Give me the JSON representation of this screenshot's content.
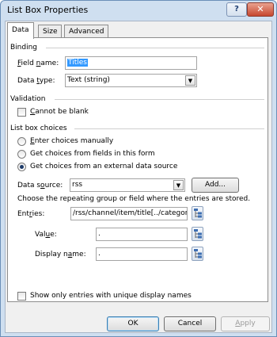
{
  "window": {
    "title": "List Box Properties",
    "help_glyph": "?",
    "close_glyph": "✕"
  },
  "tabs": [
    {
      "label": "Data",
      "active": true
    },
    {
      "label": "Size",
      "active": false
    },
    {
      "label": "Advanced",
      "active": false
    }
  ],
  "binding": {
    "heading": "Binding",
    "field_name_label": "Field name:",
    "field_name_value": "Titles",
    "data_type_label": "Data type:",
    "data_type_value": "Text (string)"
  },
  "validation": {
    "heading": "Validation",
    "cannot_be_blank_label": "Cannot be blank",
    "cannot_be_blank_checked": false
  },
  "choices": {
    "heading": "List box choices",
    "options": [
      {
        "label": "Enter choices manually",
        "selected": false
      },
      {
        "label": "Get choices from fields in this form",
        "selected": false
      },
      {
        "label": "Get choices from an external data source",
        "selected": true
      }
    ],
    "data_source_label": "Data source:",
    "data_source_value": "rss",
    "add_button": "Add...",
    "instruction": "Choose the repeating group or field where the entries are stored.",
    "entries_label": "Entries:",
    "entries_value": "/rss/channel/item/title[../category",
    "value_label": "Value:",
    "value_value": ".",
    "display_name_label": "Display name:",
    "display_name_value": ".",
    "unique_label": "Show only entries with unique display names",
    "unique_checked": false
  },
  "footer": {
    "ok": "OK",
    "cancel": "Cancel",
    "apply": "Apply"
  }
}
